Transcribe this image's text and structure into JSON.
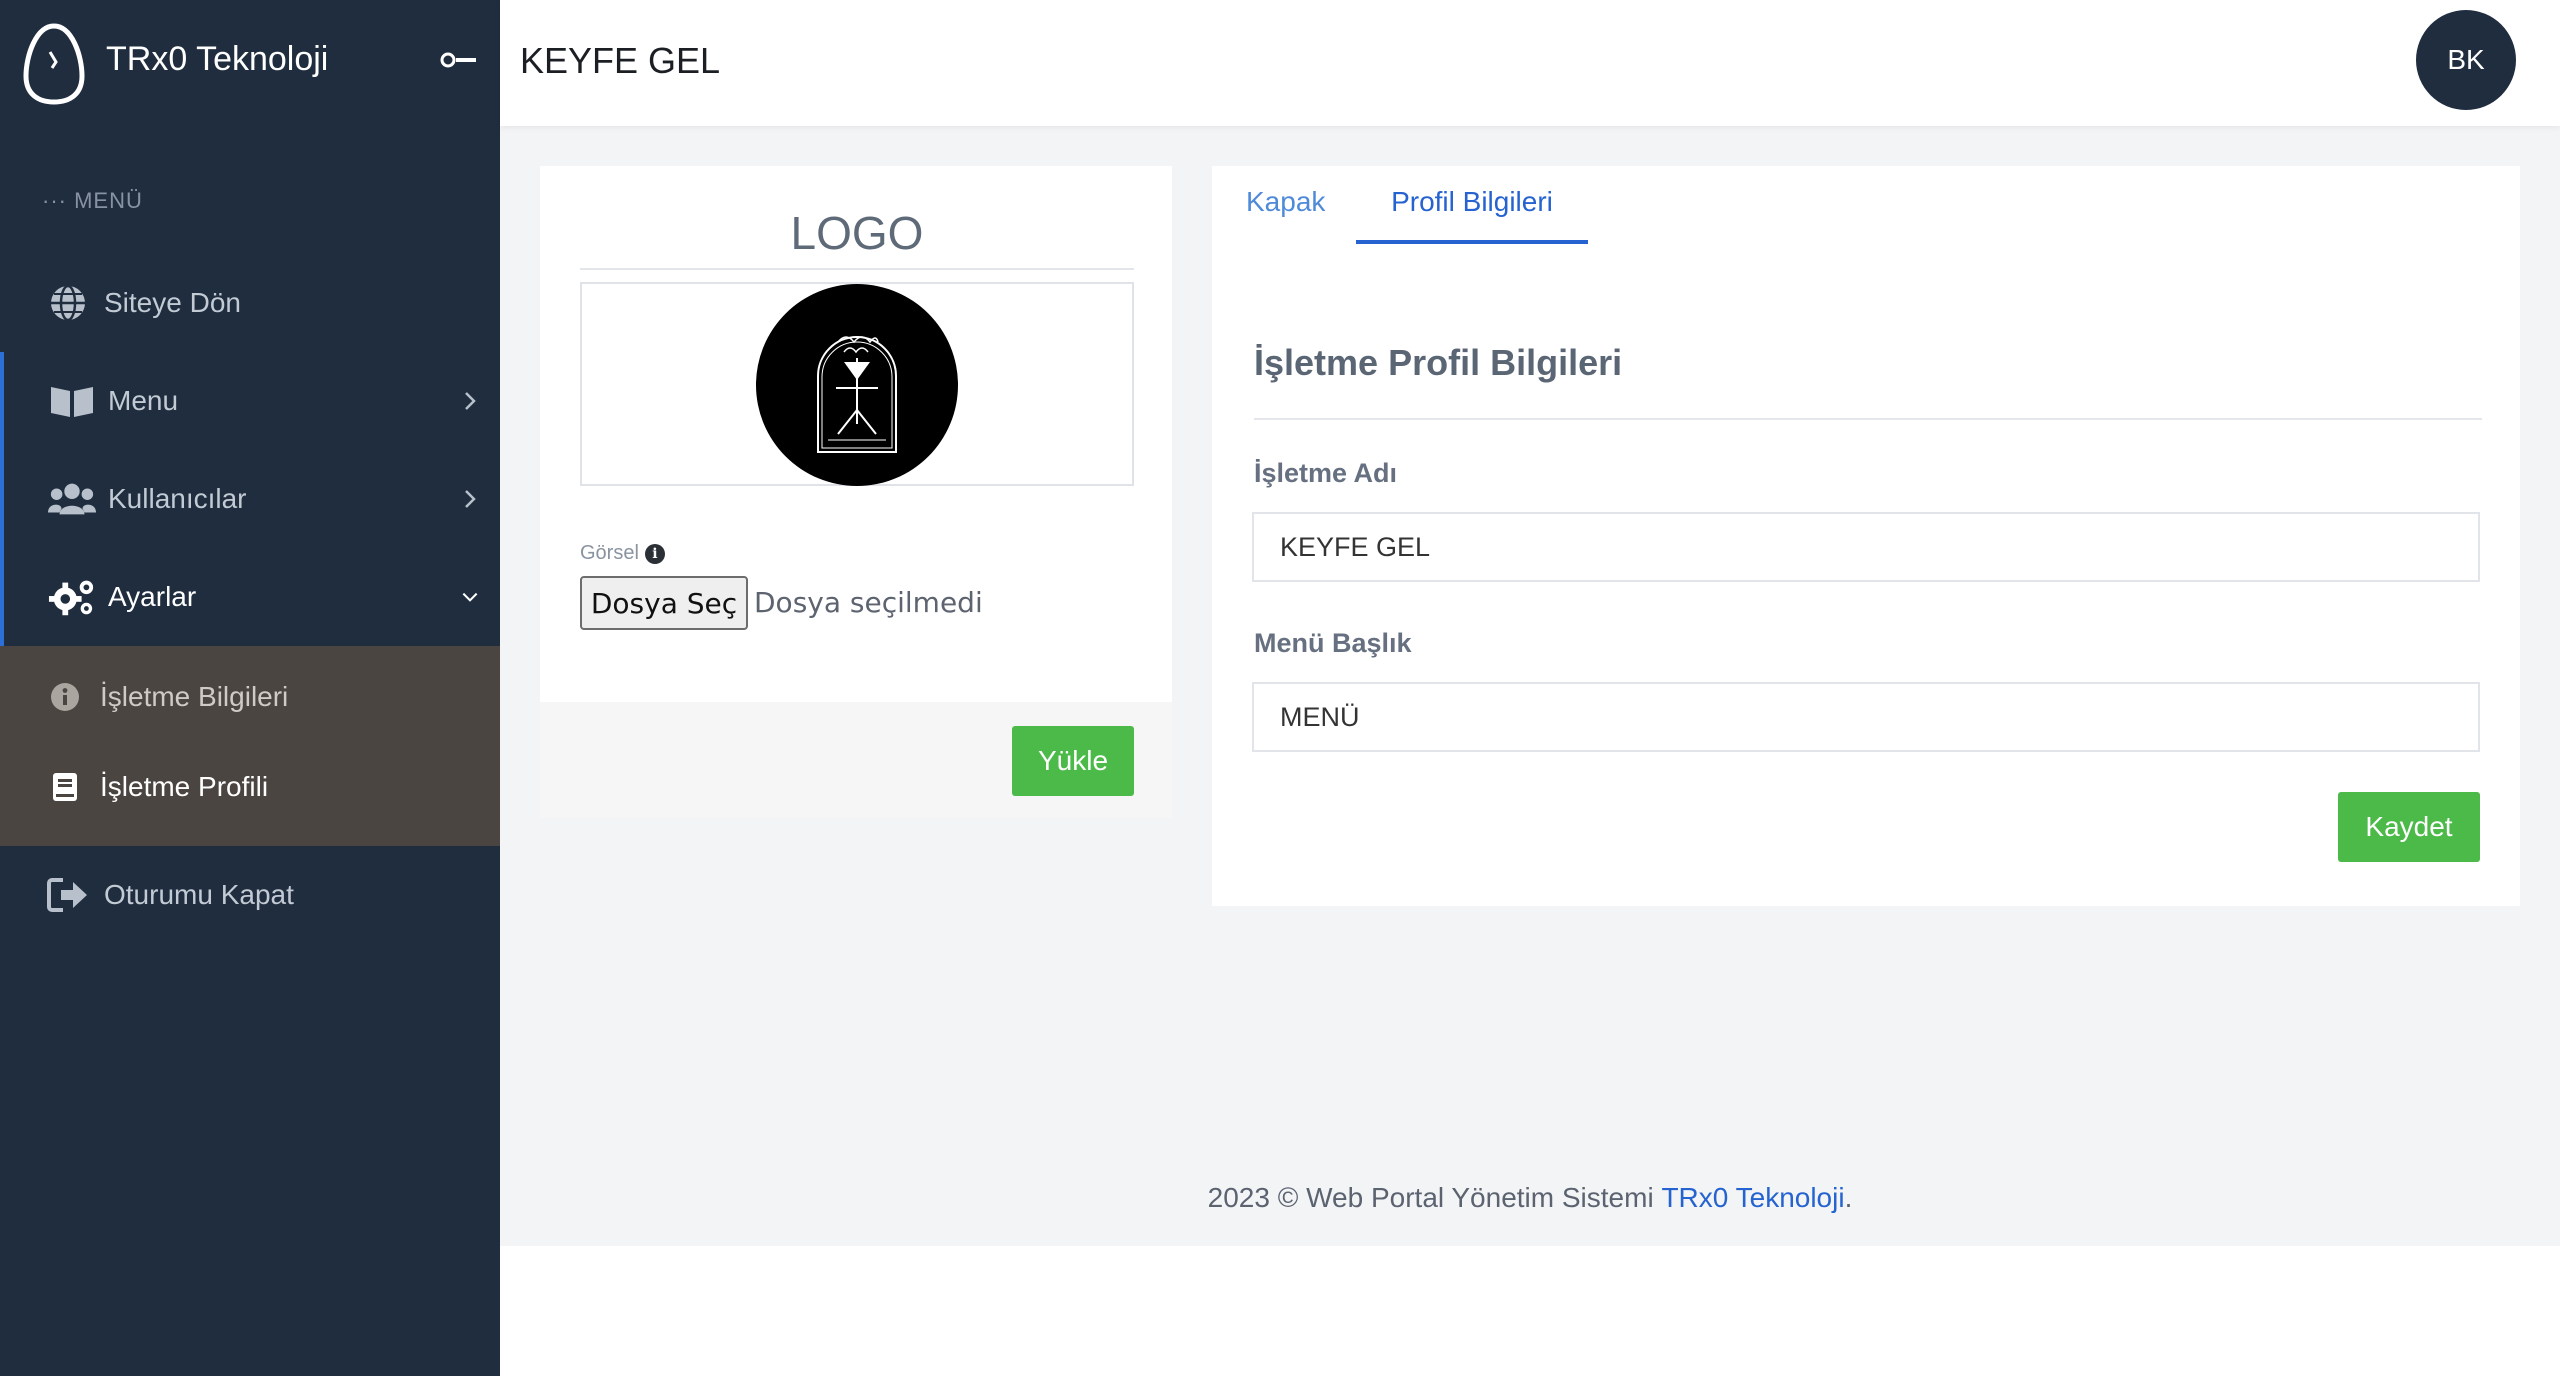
{
  "brand": {
    "name": "TRx0 Teknoloji"
  },
  "sidebar": {
    "menu_heading": "··· MENÜ",
    "items": [
      {
        "label": "Siteye Dön",
        "icon": "globe-icon"
      },
      {
        "label": "Menu",
        "icon": "book-open-icon"
      },
      {
        "label": "Kullanıcılar",
        "icon": "users-icon"
      },
      {
        "label": "Ayarlar",
        "icon": "gears-icon"
      },
      {
        "label": "Oturumu Kapat",
        "icon": "sign-out-icon"
      }
    ],
    "sub_items": [
      {
        "label": "İşletme Bilgileri",
        "icon": "info-circle-icon"
      },
      {
        "label": "İşletme Profili",
        "icon": "book-icon"
      }
    ]
  },
  "header": {
    "title": "KEYFE GEL",
    "avatar_initials": "BK"
  },
  "logo_card": {
    "title": "LOGO",
    "image_label": "Görsel",
    "file_button": "Dosya Seç",
    "file_status": "Dosya seçilmedi",
    "upload_button": "Yükle"
  },
  "profile_card": {
    "tabs": [
      "Kapak",
      "Profil Bilgileri"
    ],
    "active_tab": "Profil Bilgileri",
    "section_title": "İşletme Profil Bilgileri",
    "fields": [
      {
        "label": "İşletme Adı",
        "value": "KEYFE GEL"
      },
      {
        "label": "Menü Başlık",
        "value": "MENÜ"
      }
    ],
    "save_button": "Kaydet"
  },
  "footer": {
    "prefix": "2023 © Web Portal Yönetim Sistemi ",
    "link": "TRx0 Teknoloji",
    "suffix": "."
  },
  "colors": {
    "sidebar": "#1f2d3f",
    "accent": "#2563d0",
    "success": "#4cba48",
    "submenu": "#4a4541"
  }
}
